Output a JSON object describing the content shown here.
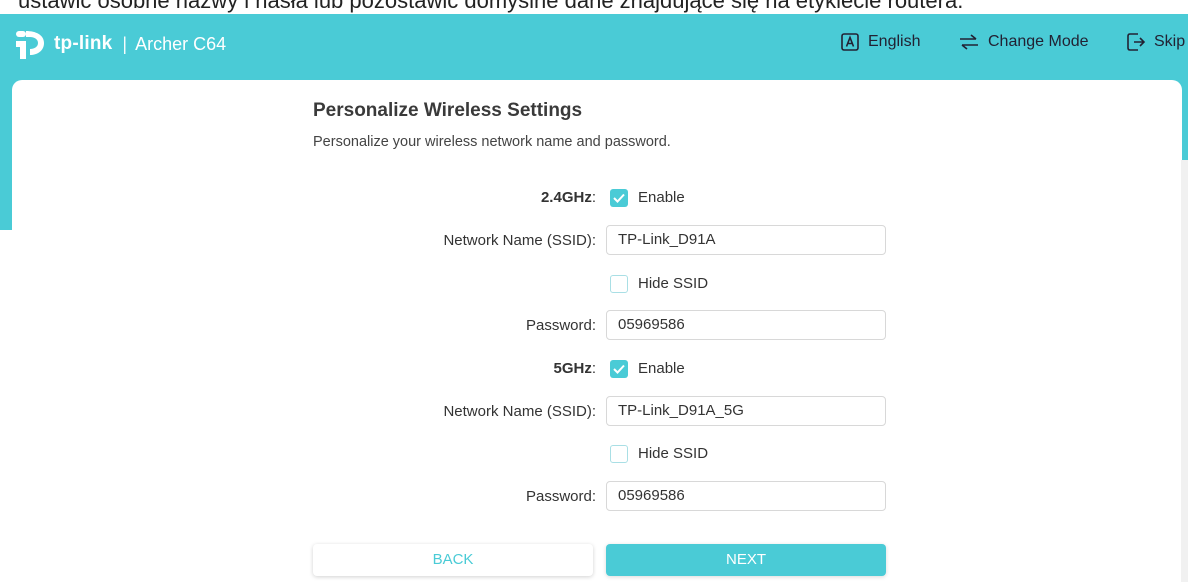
{
  "top_caption": "ustawić osobne nazwy i hasła lub pozostawić domyślne dane znajdujące się na etykiecie routera.",
  "header": {
    "brand": "tp-link",
    "separator": "|",
    "model": "Archer C64",
    "nav": {
      "language": "English",
      "change_mode": "Change Mode",
      "skip": "Skip"
    },
    "accent_color": "#4acbd6"
  },
  "page": {
    "title": "Personalize Wireless Settings",
    "subtitle": "Personalize your wireless network name and password."
  },
  "band_24": {
    "label": "2.4GHz",
    "colon": ":",
    "enable_label": "Enable",
    "enabled": true,
    "ssid_label": "Network Name (SSID):",
    "ssid_value": "TP-Link_D91A",
    "hide_ssid_label": "Hide SSID",
    "hide_ssid": false,
    "password_label": "Password:",
    "password_value": "05969586"
  },
  "band_5": {
    "label": "5GHz",
    "colon": ":",
    "enable_label": "Enable",
    "enabled": true,
    "ssid_label": "Network Name (SSID):",
    "ssid_value": "TP-Link_D91A_5G",
    "hide_ssid_label": "Hide SSID",
    "hide_ssid": false,
    "password_label": "Password:",
    "password_value": "05969586"
  },
  "buttons": {
    "back": "BACK",
    "next": "NEXT"
  }
}
